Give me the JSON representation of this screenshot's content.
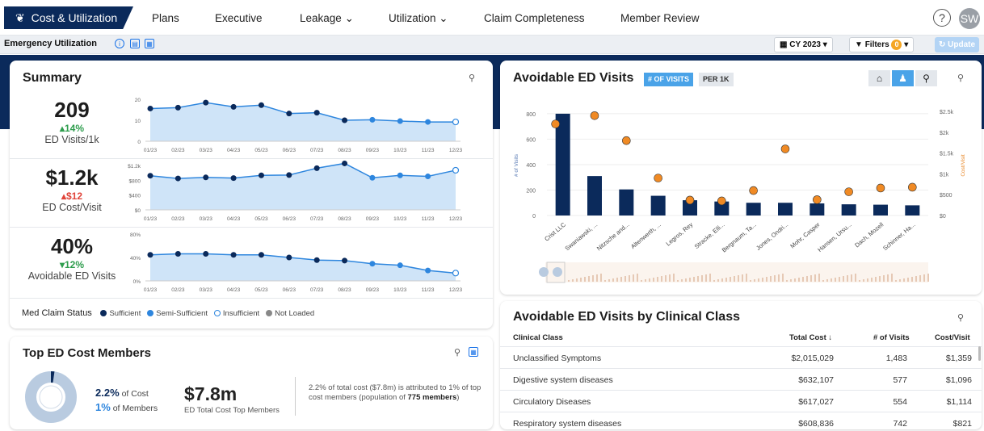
{
  "nav": {
    "active": "Cost & Utilization",
    "items": [
      "Plans",
      "Executive",
      "Leakage",
      "Utilization",
      "Claim Completeness",
      "Member Review"
    ],
    "help": "?",
    "avatar": "SW"
  },
  "subbar": {
    "title": "Emergency Utilization",
    "period": "CY 2023",
    "filters": "Filters",
    "filter_count": "0",
    "update": "Update"
  },
  "summary": {
    "title": "Summary",
    "months": [
      "01/23",
      "02/23",
      "03/23",
      "04/23",
      "05/23",
      "06/23",
      "07/23",
      "08/23",
      "09/23",
      "10/23",
      "11/23",
      "12/23"
    ],
    "rows": [
      {
        "value": "209",
        "delta": "14%",
        "dir": "up",
        "label": "ED Visits/1k",
        "yticks": [
          "20",
          "10",
          "0"
        ],
        "ymax": 25,
        "points": [
          19.5,
          20,
          23,
          20.5,
          21.5,
          16.5,
          17,
          12.5,
          12.8,
          12,
          11.5,
          11.5
        ]
      },
      {
        "value": "$1.2k",
        "delta": "$12",
        "dir": "up-red",
        "label": "ED Cost/Visit",
        "yticks": [
          "$1.2k",
          "$800",
          "$400",
          "$0"
        ],
        "ymax": 1300,
        "points": [
          1000,
          920,
          950,
          930,
          1010,
          1020,
          1220,
          1360,
          940,
          1010,
          980,
          1160
        ]
      },
      {
        "value": "40%",
        "delta": "12%",
        "dir": "down",
        "label": "Avoidable ED Visits",
        "yticks": [
          "80%",
          "40%",
          "0%"
        ],
        "ymax": 90,
        "points": [
          50,
          52,
          52,
          50,
          50,
          45,
          40,
          39,
          33,
          30,
          20,
          15
        ]
      }
    ],
    "legend_title": "Med Claim Status",
    "legend": [
      {
        "label": "Sufficient",
        "color": "#0b2a5b"
      },
      {
        "label": "Semi-Sufficient",
        "color": "#2e86de"
      },
      {
        "label": "Insufficient",
        "color": "#ffffff"
      },
      {
        "label": "Not Loaded",
        "color": "#888888"
      }
    ]
  },
  "top_members": {
    "title": "Top ED Cost Members",
    "pct_cost": "2.2%",
    "pct_cost_lbl": "of Cost",
    "pct_members": "1%",
    "pct_members_lbl": "of Members",
    "total": "$7.8m",
    "total_lbl": "ED Total Cost Top Members",
    "note_pre": "2.2% of total cost ($7.8m) is attributed to 1% of top cost members (population of ",
    "note_bold": "775 members",
    "note_post": ")"
  },
  "avoidable": {
    "title": "Avoidable ED Visits",
    "tab1": "# OF VISITS",
    "tab2": "PER 1K",
    "y_left_label": "# of Visits",
    "y_right_label": "Cost/Visit"
  },
  "chart_data": {
    "type": "bar",
    "categories": [
      "Crist LLC",
      "Swaniawski, ...",
      "Nitzsche and...",
      "Altenwerth, ...",
      "Legros, Rey",
      "Stracke, Elli...",
      "Bergnaum, Ta...",
      "Jones, Ondri...",
      "Mohr, Casper",
      "Hansen, Ursu...",
      "Dach, Mozell",
      "Schinner, Ha..."
    ],
    "series": [
      {
        "name": "# of Visits",
        "values": [
          800,
          310,
          205,
          155,
          120,
          110,
          100,
          100,
          95,
          88,
          85,
          80
        ]
      },
      {
        "name": "Cost/Visit",
        "values": [
          2200,
          2400,
          1800,
          900,
          370,
          350,
          600,
          1600,
          380,
          570,
          660,
          680
        ]
      }
    ],
    "ylim": [
      0,
      850
    ],
    "y2lim": [
      0,
      2600
    ],
    "yticks": [
      "800",
      "600",
      "400",
      "200",
      "0"
    ],
    "y2ticks": [
      "$2.5k",
      "$2k",
      "$1.5k",
      "$1k",
      "$500",
      "$0"
    ]
  },
  "clinical": {
    "title": "Avoidable ED Visits by Clinical Class",
    "headers": [
      "Clinical Class",
      "Total Cost ↓",
      "# of Visits",
      "Cost/Visit"
    ],
    "rows": [
      [
        "Unclassified Symptoms",
        "$2,015,029",
        "1,483",
        "$1,359"
      ],
      [
        "Digestive system diseases",
        "$632,107",
        "577",
        "$1,096"
      ],
      [
        "Circulatory Diseases",
        "$617,027",
        "554",
        "$1,114"
      ],
      [
        "Respiratory system diseases",
        "$608,836",
        "742",
        "$821"
      ]
    ]
  }
}
